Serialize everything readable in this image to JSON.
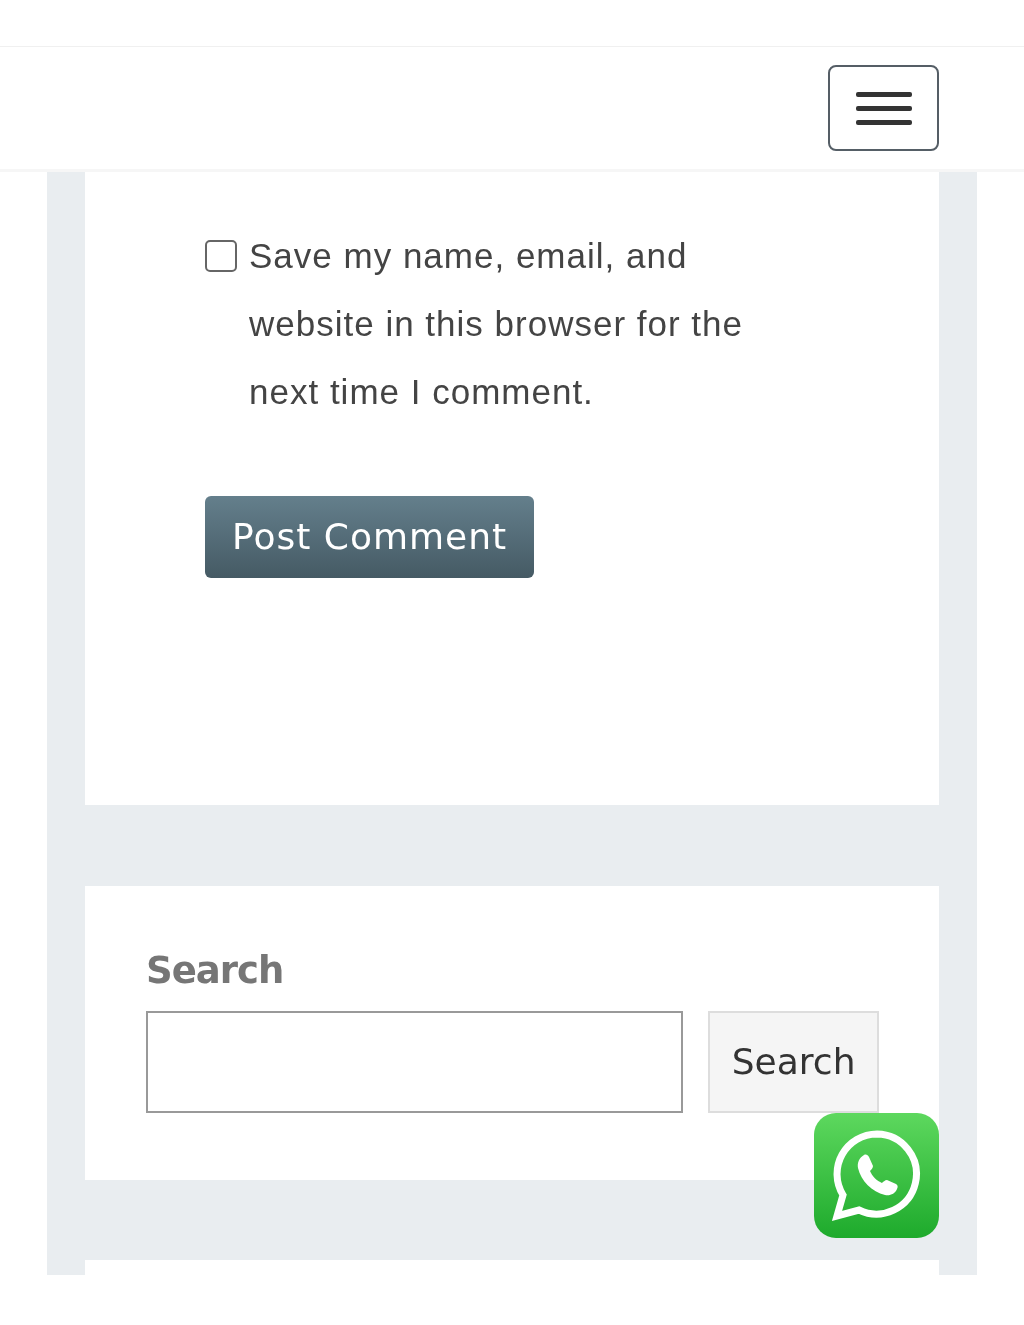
{
  "header": {
    "menu_button": {
      "expanded": false
    }
  },
  "comment_form": {
    "save_info": {
      "label": "Save my name, email, and website in this browser for the next time I comment.",
      "checked": false
    },
    "submit": "Post Comment"
  },
  "search_widget": {
    "title": "Search",
    "button": "Search"
  }
}
